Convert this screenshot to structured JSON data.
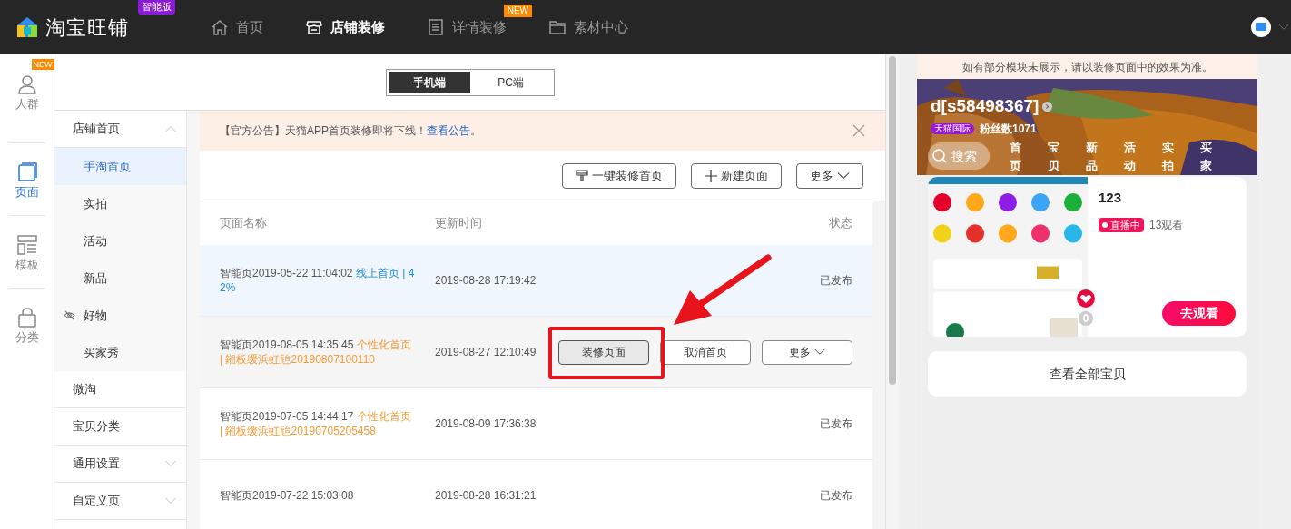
{
  "topbar": {
    "logo": "淘宝旺铺",
    "edition": "智能版",
    "nav": [
      {
        "label": "首页",
        "selected": false
      },
      {
        "label": "店铺装修",
        "selected": true
      },
      {
        "label": "详情装修",
        "selected": false,
        "badge": "NEW"
      },
      {
        "label": "素材中心",
        "selected": false
      }
    ]
  },
  "rail": [
    {
      "label": "人群",
      "selected": false,
      "badge": "NEW"
    },
    {
      "label": "页面",
      "selected": true
    },
    {
      "label": "模板",
      "selected": false
    },
    {
      "label": "分类",
      "selected": false
    }
  ],
  "device_tabs": [
    {
      "label": "手机端",
      "selected": true
    },
    {
      "label": "PC端",
      "selected": false
    }
  ],
  "sidebar": [
    {
      "label": "店铺首页",
      "expanded": true,
      "children": [
        {
          "label": "手淘首页",
          "selected": true,
          "hidden": false
        },
        {
          "label": "实拍",
          "selected": false,
          "hidden": false
        },
        {
          "label": "活动",
          "selected": false,
          "hidden": false
        },
        {
          "label": "新品",
          "selected": false,
          "hidden": false
        },
        {
          "label": "好物",
          "selected": false,
          "hidden": true
        },
        {
          "label": "买家秀",
          "selected": false,
          "hidden": false
        }
      ]
    },
    {
      "label": "微淘"
    },
    {
      "label": "宝贝分类"
    },
    {
      "label": "通用设置",
      "expanded": false
    },
    {
      "label": "自定义页",
      "expanded": false
    }
  ],
  "notice": {
    "text": "【官方公告】天猫APP首页装修即将下线！",
    "link": "查看公告",
    "tail": "。"
  },
  "toolbar": [
    "一键装修首页",
    "新建页面",
    "更多"
  ],
  "table": {
    "columns": [
      "页面名称",
      "更新时间",
      "状态"
    ],
    "rows": [
      {
        "name": "智能页2019-05-22 11:04:02 ",
        "tag": {
          "text": "线上首页 | 42%",
          "color": "#1e8ad6"
        },
        "time": "2019-08-28 17:19:42",
        "status": "已发布",
        "highlighted": true
      },
      {
        "name": "智能页2019-08-05 14:35:45 ",
        "tag": {
          "text": "个性化首页 | 鎺板缓浜虹兘20190807100110",
          "color": "#f59a36"
        },
        "time": "2019-08-27 12:10:49",
        "highlighted": false,
        "hovered": true,
        "actions": [
          "装修页面",
          "取消首页",
          "更多"
        ]
      },
      {
        "name": "智能页2019-07-05 14:44:17 ",
        "tag": {
          "text": "个性化首页 | 鎺板缓浜虹兘20190705205458",
          "color": "#f59a36"
        },
        "time": "2019-08-09 17:36:38",
        "status": "已发布",
        "highlighted": false
      },
      {
        "name": "智能页2019-07-22 15:03:08",
        "time": "2019-08-28 16:31:21",
        "status": "已发布",
        "highlighted": false
      }
    ]
  },
  "preview": {
    "notice": "如有部分模块未展示，请以装修页面中的效果为准。",
    "shop_name": "d[s58498367]",
    "shop_badge": "天猫国际",
    "fans": "粉丝数1071",
    "search": "搜索",
    "nav": [
      "首页",
      "宝贝",
      "新品",
      "活动",
      "实拍",
      "买家"
    ],
    "live": {
      "likes": "0",
      "title": "123",
      "badge": "直播中",
      "viewers": "13观看",
      "button": "去观看"
    },
    "all_items": "查看全部宝贝"
  }
}
